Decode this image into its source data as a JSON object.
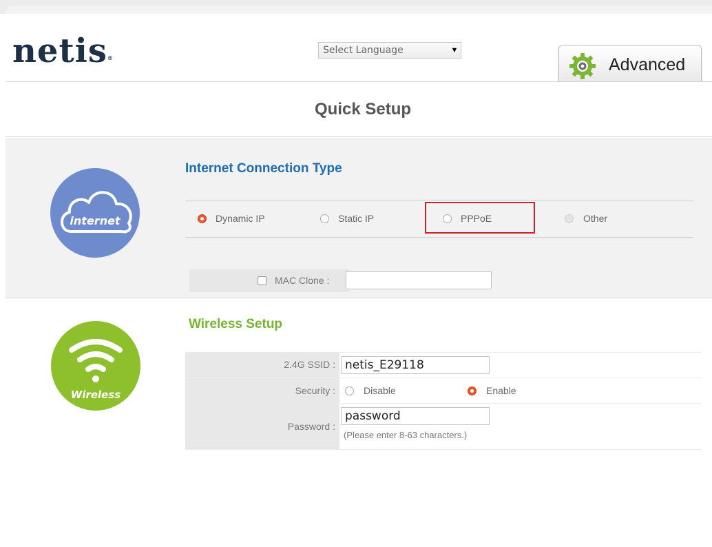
{
  "header": {
    "logo": "netis",
    "logo_mark": "®",
    "language_select": {
      "selected": "Select Language"
    },
    "advanced_button": {
      "label": "Advanced",
      "icon": "gear-icon"
    }
  },
  "page_title": "Quick Setup",
  "internet": {
    "icon_label": "internet",
    "section_title": "Internet Connection Type",
    "options": [
      {
        "label": "Dynamic IP",
        "state": "selected"
      },
      {
        "label": "Static IP",
        "state": "unselected"
      },
      {
        "label": "PPPoE",
        "state": "unselected",
        "highlighted": true
      },
      {
        "label": "Other",
        "state": "disabled"
      }
    ],
    "mac_clone": {
      "label": "MAC Clone :",
      "checked": false,
      "value": ""
    }
  },
  "wireless": {
    "icon_label": "Wireless",
    "section_title": "Wireless Setup",
    "ssid": {
      "label": "2.4G SSID :",
      "value": "netis_E29118"
    },
    "security": {
      "label": "Security :",
      "options": [
        {
          "label": "Disable",
          "state": "unselected"
        },
        {
          "label": "Enable",
          "state": "selected"
        }
      ]
    },
    "password": {
      "label": "Password :",
      "value": "password",
      "hint": "(Please enter 8-63 characters.)"
    }
  },
  "colors": {
    "internet_circle": "#6e8ccd",
    "wireless_circle": "#8dc02c",
    "section_title_blue": "#1e6db0",
    "section_title_green": "#74b630",
    "radio_selected": "#ee5a27",
    "highlight_box": "#c8242b"
  }
}
